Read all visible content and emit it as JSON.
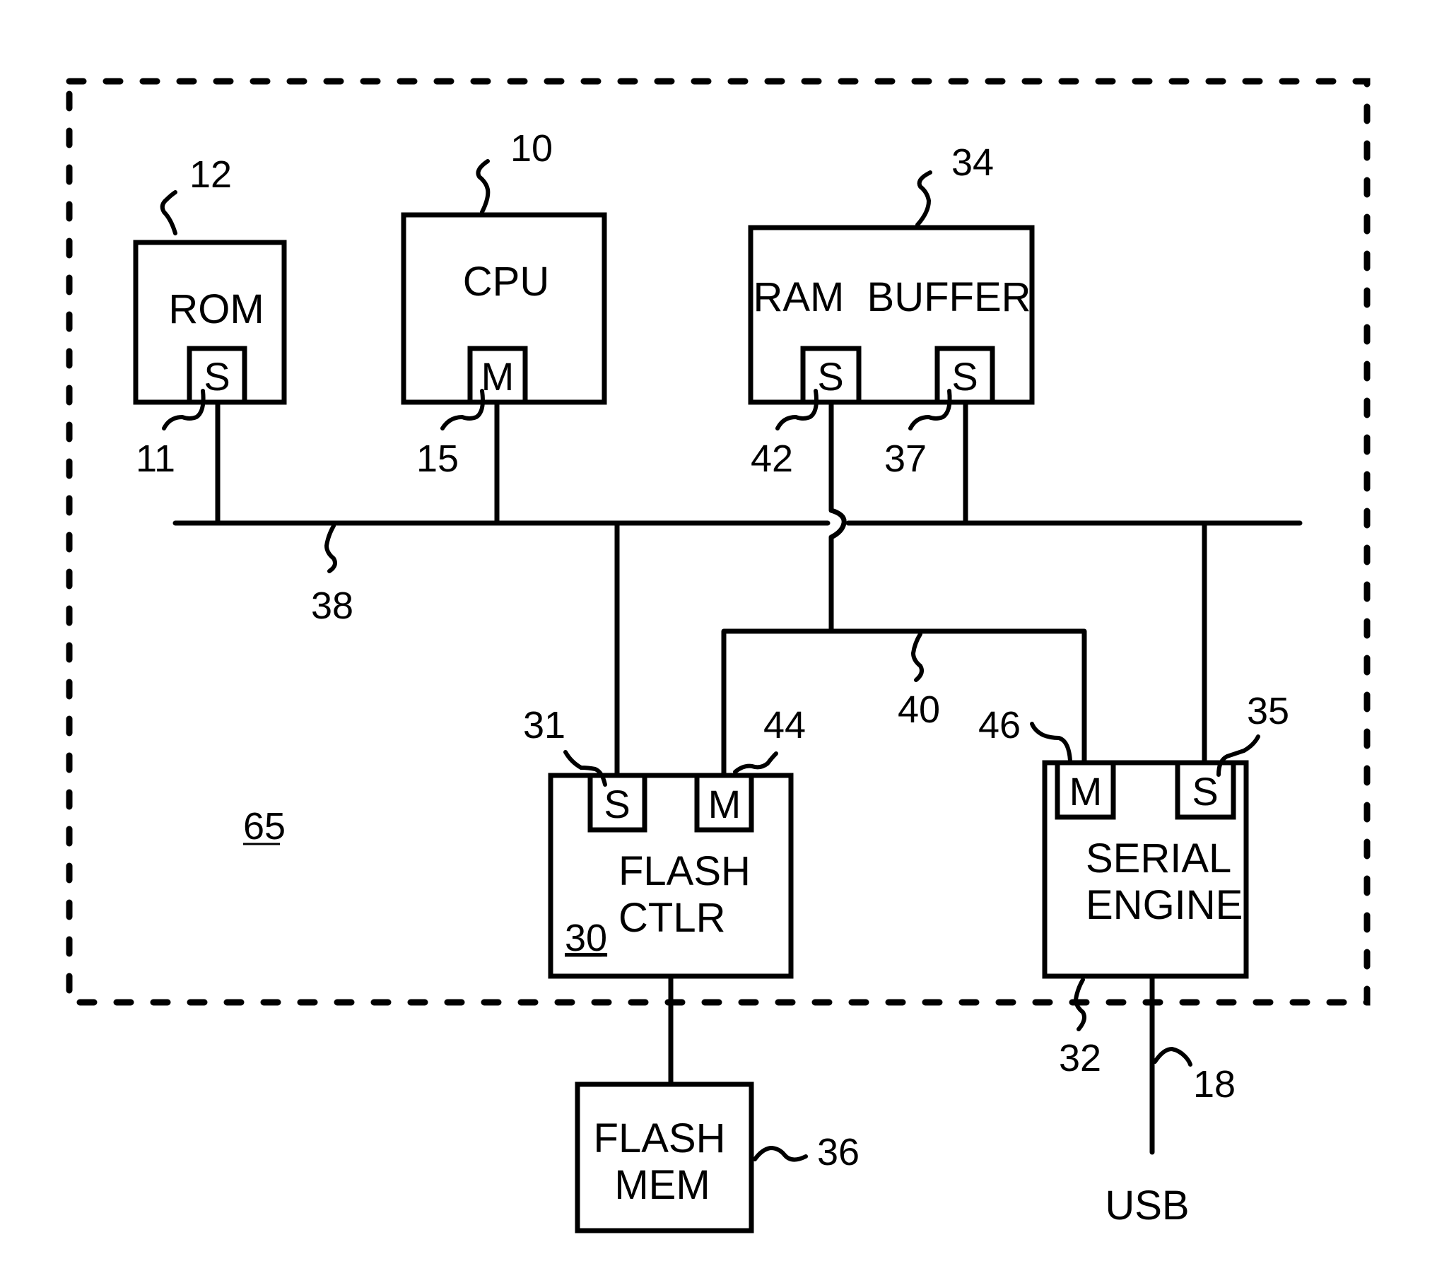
{
  "figure": {
    "container": {
      "ref": "65"
    },
    "blocks": {
      "rom": {
        "label": "ROM",
        "ref": "12",
        "port": "S",
        "port_ref": "11"
      },
      "cpu": {
        "label": "CPU",
        "ref": "10",
        "port": "M",
        "port_ref": "15"
      },
      "ram_buffer": {
        "label": "RAM  BUFFER",
        "ref": "34",
        "ports": [
          {
            "label": "S",
            "ref": "42"
          },
          {
            "label": "S",
            "ref": "37"
          }
        ]
      },
      "flash_ctlr": {
        "line1": "FLASH",
        "line2": "CTLR",
        "ref": "30",
        "ports": [
          {
            "label": "S",
            "ref": "31"
          },
          {
            "label": "M",
            "ref": "44"
          }
        ]
      },
      "serial_engine": {
        "line1": "SERIAL",
        "line2": "ENGINE",
        "ref": "32",
        "ports": [
          {
            "label": "M",
            "ref": "46"
          },
          {
            "label": "S",
            "ref": "35"
          }
        ]
      },
      "flash_mem": {
        "line1": "FLASH",
        "line2": "MEM",
        "ref": "36"
      }
    },
    "buses": {
      "main_bus": {
        "ref": "38"
      },
      "secondary_bus": {
        "ref": "40"
      },
      "usb_line": {
        "ref": "18",
        "label": "USB"
      }
    }
  }
}
